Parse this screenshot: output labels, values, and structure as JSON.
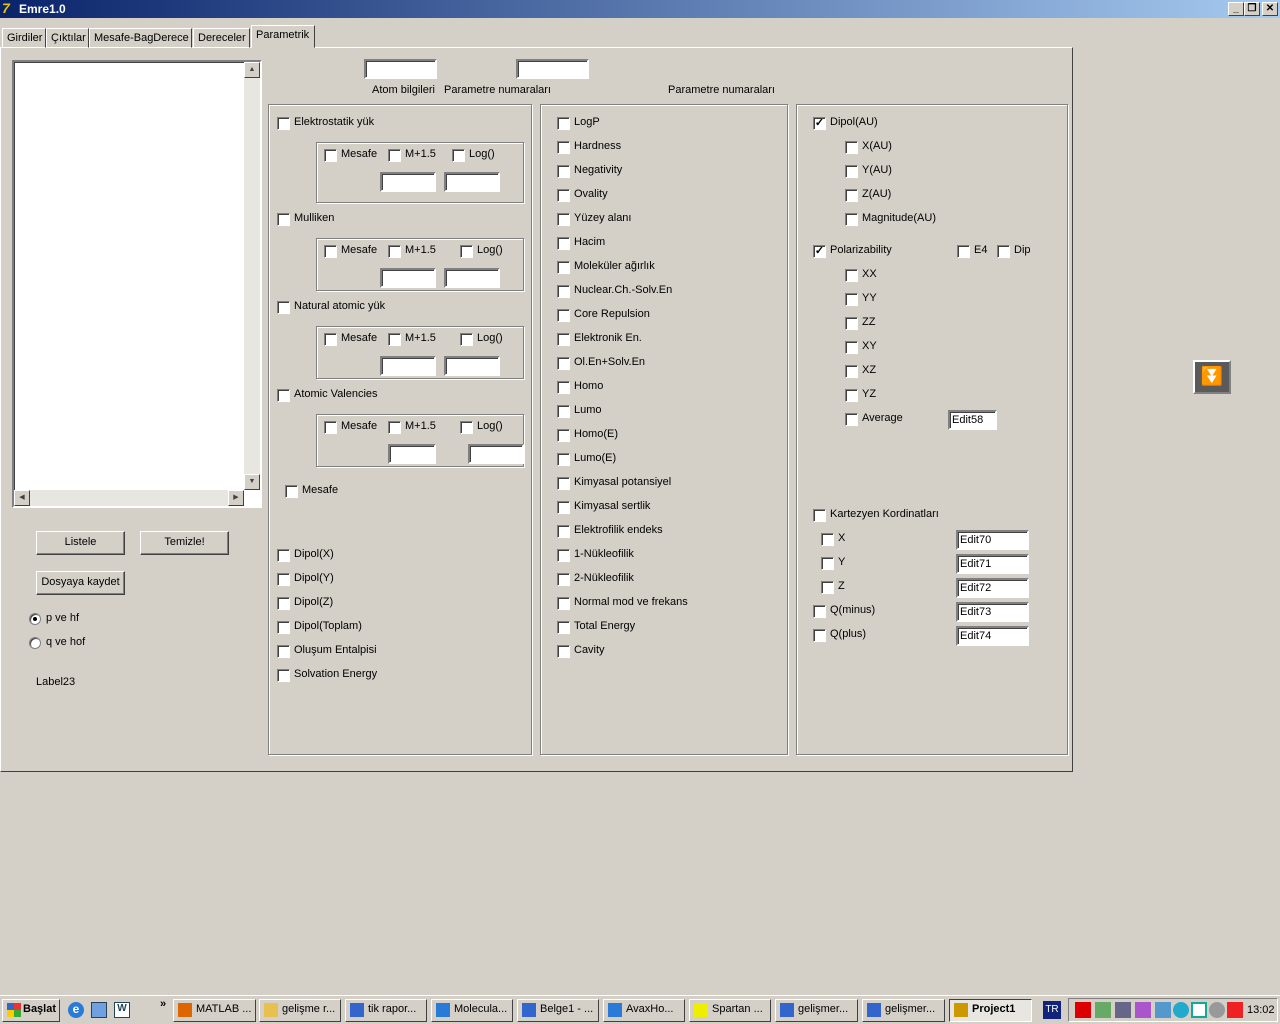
{
  "window": {
    "title": "Emre1.0",
    "minimize": "_",
    "restore": "❐",
    "close": "✕"
  },
  "tabs": [
    {
      "label": "Girdiler"
    },
    {
      "label": "Çıktılar"
    },
    {
      "label": "Mesafe-BagDerece"
    },
    {
      "label": "Dereceler"
    },
    {
      "label": "Parametrik",
      "active": true
    }
  ],
  "left": {
    "listele": "Listele",
    "temizle": "Temizle!",
    "dosya": "Dosyaya kaydet",
    "radios": [
      {
        "label": "p ve hf",
        "selected": true
      },
      {
        "label": "q ve hof",
        "selected": false
      }
    ],
    "label23": "Label23"
  },
  "top": {
    "atom_value": "",
    "param_value": "",
    "atom_label": "Atom bilgileri",
    "param_label1": "Parametre numaraları",
    "param_label2": "Parametre numaraları"
  },
  "panel1": {
    "groups": [
      {
        "label": "Elektrostatik yük",
        "checked": false,
        "sub": [
          "Mesafe",
          "M+1.5",
          "Log()"
        ],
        "edits": [
          "",
          ""
        ]
      },
      {
        "label": "Mulliken",
        "checked": false,
        "sub": [
          "Mesafe",
          "M+1.5",
          "Log()"
        ],
        "edits": [
          "",
          ""
        ]
      },
      {
        "label": "Natural atomic yük",
        "checked": false,
        "sub": [
          "Mesafe",
          "M+1.5",
          "Log()"
        ],
        "edits": [
          "",
          ""
        ]
      },
      {
        "label": "Atomic Valencies",
        "checked": false,
        "sub": [
          "Mesafe",
          "M+1.5",
          "Log()"
        ],
        "edits": [
          "",
          ""
        ]
      }
    ],
    "mesafe": {
      "label": "Mesafe",
      "checked": false
    },
    "items": [
      {
        "label": "Dipol(X)",
        "checked": false
      },
      {
        "label": "Dipol(Y)",
        "checked": false
      },
      {
        "label": "Dipol(Z)",
        "checked": false
      },
      {
        "label": "Dipol(Toplam)",
        "checked": false
      },
      {
        "label": "Oluşum Entalpisi",
        "checked": false
      },
      {
        "label": "Solvation Energy",
        "checked": false
      }
    ]
  },
  "panel2": {
    "items": [
      {
        "label": "LogP"
      },
      {
        "label": "Hardness"
      },
      {
        "label": "Negativity"
      },
      {
        "label": "Ovality"
      },
      {
        "label": "Yüzey alanı"
      },
      {
        "label": "Hacim"
      },
      {
        "label": "Moleküler ağırlık"
      },
      {
        "label": "Nuclear.Ch.-Solv.En"
      },
      {
        "label": "Core Repulsion"
      },
      {
        "label": "Elektronik En."
      },
      {
        "label": "Ol.En+Solv.En"
      },
      {
        "label": "Homo"
      },
      {
        "label": "Lumo"
      },
      {
        "label": "Homo(E)"
      },
      {
        "label": "Lumo(E)"
      },
      {
        "label": "Kimyasal potansiyel"
      },
      {
        "label": "Kimyasal sertlik"
      },
      {
        "label": "Elektrofilik endeks"
      },
      {
        "label": "1-Nükleofilik"
      },
      {
        "label": "2-Nükleofilik"
      },
      {
        "label": "Normal mod ve frekans"
      },
      {
        "label": "Total Energy"
      },
      {
        "label": "Cavity"
      }
    ]
  },
  "panel3": {
    "dipol": {
      "label": "Dipol(AU)",
      "checked": true,
      "components": [
        {
          "label": "X(AU)"
        },
        {
          "label": "Y(AU)"
        },
        {
          "label": "Z(AU)"
        },
        {
          "label": "Magnitude(AU)"
        }
      ]
    },
    "polar": {
      "label": "Polarizability",
      "checked": true,
      "e4": "E4",
      "dip": "Dip",
      "components": [
        {
          "label": "XX"
        },
        {
          "label": "YY"
        },
        {
          "label": "ZZ"
        },
        {
          "label": "XY"
        },
        {
          "label": "XZ"
        },
        {
          "label": "YZ"
        },
        {
          "label": "Average"
        }
      ],
      "average_value": "Edit58"
    },
    "kartezyen": {
      "label": "Kartezyen Kordinatları",
      "checked": false,
      "items": [
        {
          "label": "X",
          "value": "Edit70"
        },
        {
          "label": "Y",
          "value": "Edit71"
        },
        {
          "label": "Z",
          "value": "Edit72"
        },
        {
          "label": "Q(minus)",
          "value": "Edit73"
        },
        {
          "label": "Q(plus)",
          "value": "Edit74"
        }
      ]
    }
  },
  "side_button_icon": "chevron-triple-down-icon",
  "taskbar": {
    "start": "Başlat",
    "quick": [
      "ie-icon",
      "outlook-icon",
      "word-icon"
    ],
    "more": "»",
    "tasks": [
      {
        "label": "MATLAB ...",
        "icon": "matlab-icon"
      },
      {
        "label": "gelişme r...",
        "icon": "folder-icon"
      },
      {
        "label": "tik rapor...",
        "icon": "word-icon"
      },
      {
        "label": "Molecula...",
        "icon": "ie-icon"
      },
      {
        "label": "Belge1 - ...",
        "icon": "word-icon"
      },
      {
        "label": "AvaxHo...",
        "icon": "ie-icon"
      },
      {
        "label": "Spartan ...",
        "icon": "spartan-icon"
      },
      {
        "label": "gelişmer...",
        "icon": "word-icon"
      },
      {
        "label": "gelişmer...",
        "icon": "word-icon"
      },
      {
        "label": "Project1",
        "icon": "app-icon",
        "active": true
      }
    ],
    "lang": "TR",
    "clock": "13:02"
  }
}
